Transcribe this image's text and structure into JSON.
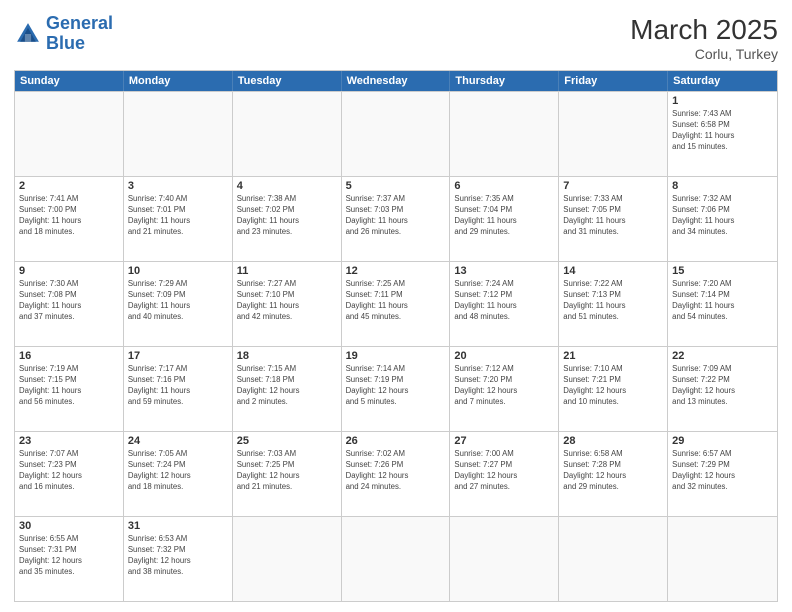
{
  "header": {
    "logo_general": "General",
    "logo_blue": "Blue",
    "title": "March 2025",
    "subtitle": "Corlu, Turkey"
  },
  "days_of_week": [
    "Sunday",
    "Monday",
    "Tuesday",
    "Wednesday",
    "Thursday",
    "Friday",
    "Saturday"
  ],
  "weeks": [
    [
      {
        "day": "",
        "info": ""
      },
      {
        "day": "",
        "info": ""
      },
      {
        "day": "",
        "info": ""
      },
      {
        "day": "",
        "info": ""
      },
      {
        "day": "",
        "info": ""
      },
      {
        "day": "",
        "info": ""
      },
      {
        "day": "1",
        "info": "Sunrise: 7:43 AM\nSunset: 6:58 PM\nDaylight: 11 hours\nand 15 minutes."
      }
    ],
    [
      {
        "day": "2",
        "info": "Sunrise: 7:41 AM\nSunset: 7:00 PM\nDaylight: 11 hours\nand 18 minutes."
      },
      {
        "day": "3",
        "info": "Sunrise: 7:40 AM\nSunset: 7:01 PM\nDaylight: 11 hours\nand 21 minutes."
      },
      {
        "day": "4",
        "info": "Sunrise: 7:38 AM\nSunset: 7:02 PM\nDaylight: 11 hours\nand 23 minutes."
      },
      {
        "day": "5",
        "info": "Sunrise: 7:37 AM\nSunset: 7:03 PM\nDaylight: 11 hours\nand 26 minutes."
      },
      {
        "day": "6",
        "info": "Sunrise: 7:35 AM\nSunset: 7:04 PM\nDaylight: 11 hours\nand 29 minutes."
      },
      {
        "day": "7",
        "info": "Sunrise: 7:33 AM\nSunset: 7:05 PM\nDaylight: 11 hours\nand 31 minutes."
      },
      {
        "day": "8",
        "info": "Sunrise: 7:32 AM\nSunset: 7:06 PM\nDaylight: 11 hours\nand 34 minutes."
      }
    ],
    [
      {
        "day": "9",
        "info": "Sunrise: 7:30 AM\nSunset: 7:08 PM\nDaylight: 11 hours\nand 37 minutes."
      },
      {
        "day": "10",
        "info": "Sunrise: 7:29 AM\nSunset: 7:09 PM\nDaylight: 11 hours\nand 40 minutes."
      },
      {
        "day": "11",
        "info": "Sunrise: 7:27 AM\nSunset: 7:10 PM\nDaylight: 11 hours\nand 42 minutes."
      },
      {
        "day": "12",
        "info": "Sunrise: 7:25 AM\nSunset: 7:11 PM\nDaylight: 11 hours\nand 45 minutes."
      },
      {
        "day": "13",
        "info": "Sunrise: 7:24 AM\nSunset: 7:12 PM\nDaylight: 11 hours\nand 48 minutes."
      },
      {
        "day": "14",
        "info": "Sunrise: 7:22 AM\nSunset: 7:13 PM\nDaylight: 11 hours\nand 51 minutes."
      },
      {
        "day": "15",
        "info": "Sunrise: 7:20 AM\nSunset: 7:14 PM\nDaylight: 11 hours\nand 54 minutes."
      }
    ],
    [
      {
        "day": "16",
        "info": "Sunrise: 7:19 AM\nSunset: 7:15 PM\nDaylight: 11 hours\nand 56 minutes."
      },
      {
        "day": "17",
        "info": "Sunrise: 7:17 AM\nSunset: 7:16 PM\nDaylight: 11 hours\nand 59 minutes."
      },
      {
        "day": "18",
        "info": "Sunrise: 7:15 AM\nSunset: 7:18 PM\nDaylight: 12 hours\nand 2 minutes."
      },
      {
        "day": "19",
        "info": "Sunrise: 7:14 AM\nSunset: 7:19 PM\nDaylight: 12 hours\nand 5 minutes."
      },
      {
        "day": "20",
        "info": "Sunrise: 7:12 AM\nSunset: 7:20 PM\nDaylight: 12 hours\nand 7 minutes."
      },
      {
        "day": "21",
        "info": "Sunrise: 7:10 AM\nSunset: 7:21 PM\nDaylight: 12 hours\nand 10 minutes."
      },
      {
        "day": "22",
        "info": "Sunrise: 7:09 AM\nSunset: 7:22 PM\nDaylight: 12 hours\nand 13 minutes."
      }
    ],
    [
      {
        "day": "23",
        "info": "Sunrise: 7:07 AM\nSunset: 7:23 PM\nDaylight: 12 hours\nand 16 minutes."
      },
      {
        "day": "24",
        "info": "Sunrise: 7:05 AM\nSunset: 7:24 PM\nDaylight: 12 hours\nand 18 minutes."
      },
      {
        "day": "25",
        "info": "Sunrise: 7:03 AM\nSunset: 7:25 PM\nDaylight: 12 hours\nand 21 minutes."
      },
      {
        "day": "26",
        "info": "Sunrise: 7:02 AM\nSunset: 7:26 PM\nDaylight: 12 hours\nand 24 minutes."
      },
      {
        "day": "27",
        "info": "Sunrise: 7:00 AM\nSunset: 7:27 PM\nDaylight: 12 hours\nand 27 minutes."
      },
      {
        "day": "28",
        "info": "Sunrise: 6:58 AM\nSunset: 7:28 PM\nDaylight: 12 hours\nand 29 minutes."
      },
      {
        "day": "29",
        "info": "Sunrise: 6:57 AM\nSunset: 7:29 PM\nDaylight: 12 hours\nand 32 minutes."
      }
    ],
    [
      {
        "day": "30",
        "info": "Sunrise: 6:55 AM\nSunset: 7:31 PM\nDaylight: 12 hours\nand 35 minutes."
      },
      {
        "day": "31",
        "info": "Sunrise: 6:53 AM\nSunset: 7:32 PM\nDaylight: 12 hours\nand 38 minutes."
      },
      {
        "day": "",
        "info": ""
      },
      {
        "day": "",
        "info": ""
      },
      {
        "day": "",
        "info": ""
      },
      {
        "day": "",
        "info": ""
      },
      {
        "day": "",
        "info": ""
      }
    ]
  ]
}
